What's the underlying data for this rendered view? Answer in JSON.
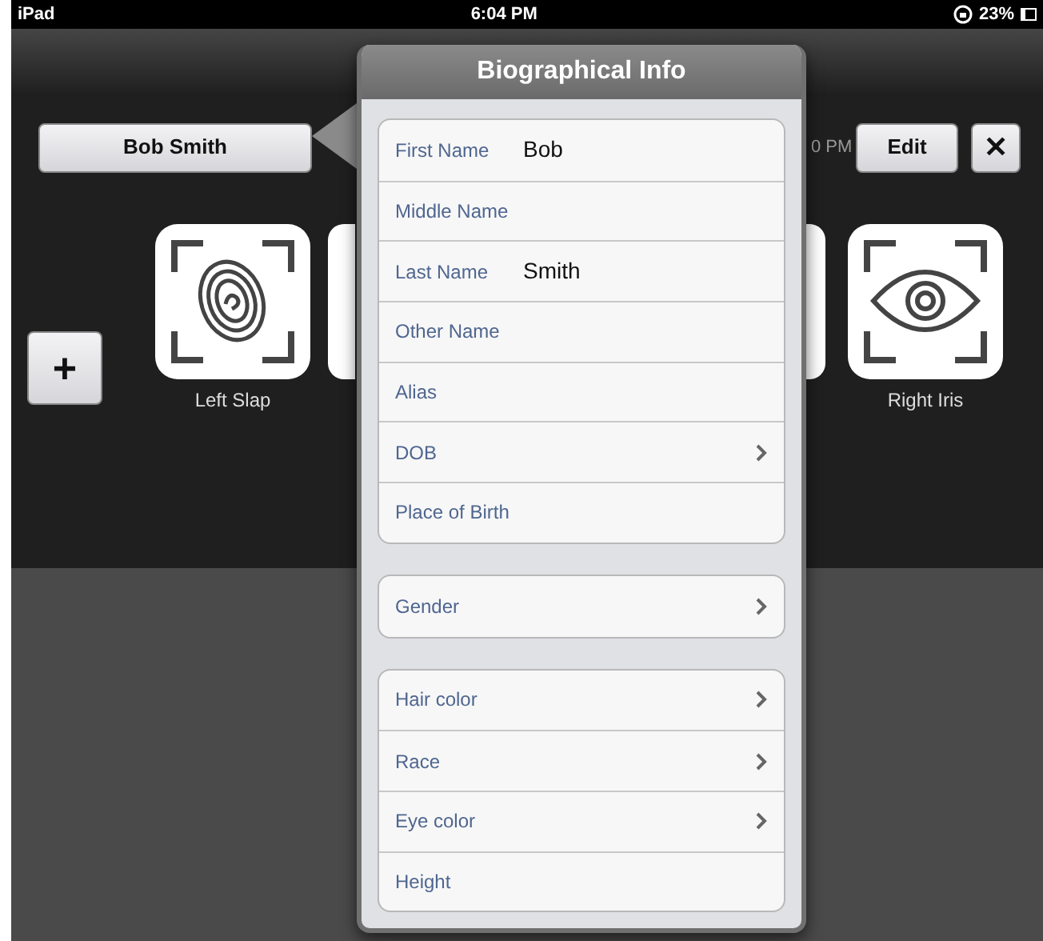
{
  "status_bar": {
    "device": "iPad",
    "time": "6:04 PM",
    "battery": "23%"
  },
  "toolbar": {
    "subject_button": "Bob Smith",
    "time_fragment": "0 PM",
    "edit_button": "Edit",
    "close_button": "✕"
  },
  "add_button": "+",
  "tiles": [
    {
      "kind": "fingerprint",
      "label": "Left Slap"
    },
    {
      "kind": "partial_left"
    },
    {
      "kind": "partial_right"
    },
    {
      "kind": "eye",
      "label": "Right Iris"
    }
  ],
  "popover": {
    "title": "Biographical Info",
    "groups": [
      {
        "rows": [
          {
            "label": "First Name",
            "value": "Bob",
            "chevron": false
          },
          {
            "label": "Middle Name",
            "chevron": false
          },
          {
            "label": "Last Name",
            "value": "Smith",
            "chevron": false
          },
          {
            "label": "Other Name",
            "chevron": false
          },
          {
            "label": "Alias",
            "chevron": false
          },
          {
            "label": "DOB",
            "chevron": true
          },
          {
            "label": "Place of Birth",
            "chevron": false
          }
        ]
      },
      {
        "rows": [
          {
            "label": "Gender",
            "chevron": true
          }
        ]
      },
      {
        "rows": [
          {
            "label": "Hair color",
            "chevron": true
          },
          {
            "label": "Race",
            "chevron": true
          },
          {
            "label": "Eye color",
            "chevron": true
          },
          {
            "label": "Height",
            "chevron": false
          }
        ]
      }
    ]
  }
}
